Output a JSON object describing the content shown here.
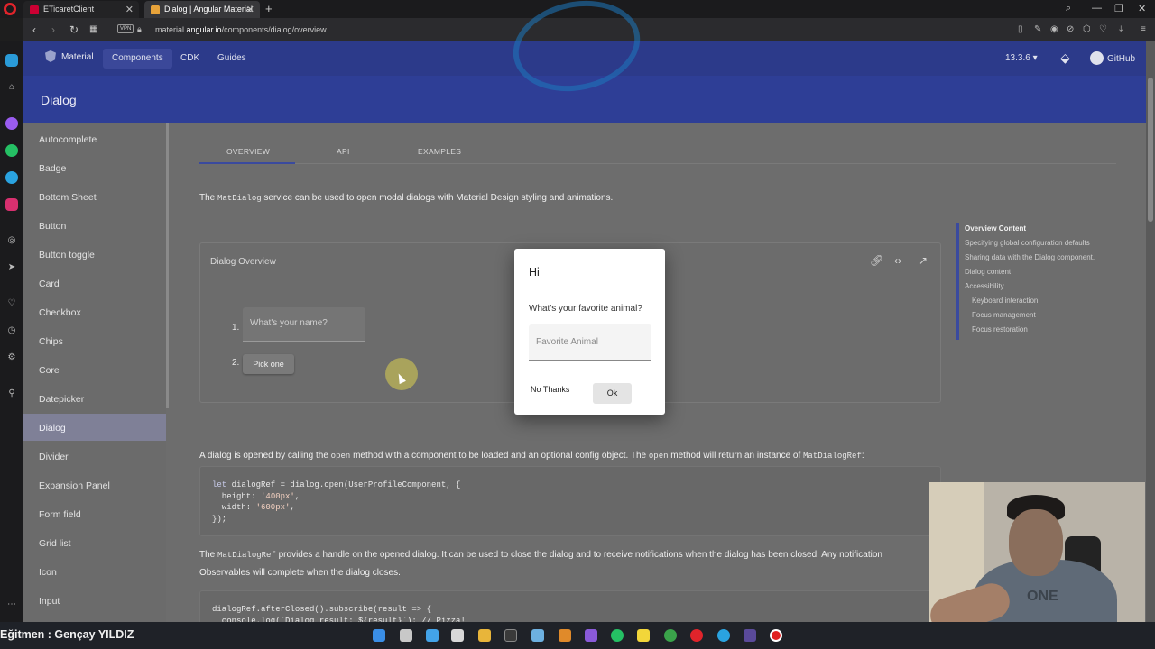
{
  "browser": {
    "tabs": [
      {
        "title": "ETicaretClient"
      },
      {
        "title": "Dialog | Angular Material",
        "active": true
      }
    ],
    "url_prefix": "material.",
    "url_host": "angular.io",
    "url_path": "/components/dialog/overview",
    "vpn_label": "VPN"
  },
  "topnav": {
    "brand": "Material",
    "links": [
      "Components",
      "CDK",
      "Guides"
    ],
    "active_link": "Components",
    "version": "13.3.6",
    "github": "GitHub"
  },
  "header": {
    "title": "Dialog"
  },
  "sidenav": {
    "items": [
      "Autocomplete",
      "Badge",
      "Bottom Sheet",
      "Button",
      "Button toggle",
      "Card",
      "Checkbox",
      "Chips",
      "Core",
      "Datepicker",
      "Dialog",
      "Divider",
      "Expansion Panel",
      "Form field",
      "Grid list",
      "Icon",
      "Input"
    ],
    "active": "Dialog"
  },
  "content": {
    "tabs": [
      "OVERVIEW",
      "API",
      "EXAMPLES"
    ],
    "intro_before": "The",
    "intro_code": "MatDialog",
    "intro_after": "service can be used to open modal dialogs with Material Design styling and animations.",
    "example": {
      "title": "Dialog Overview",
      "step1": "1.",
      "step2": "2.",
      "name_placeholder": "What's your name?",
      "pick_button": "Pick one"
    },
    "para2": {
      "a": "A dialog is opened by calling the",
      "code1": "open",
      "b": "method with a component to be loaded and an optional config object. The",
      "code2": "open",
      "c": "method will return an instance of",
      "code3": "MatDialogRef",
      "d": ":"
    },
    "code1": {
      "l1a": "let",
      "l1b": " dialogRef = dialog.open(UserProfileComponent, {",
      "l2a": "  height: ",
      "l2b": "'400px'",
      "l2c": ",",
      "l3a": "  width: ",
      "l3b": "'600px'",
      "l3c": ",",
      "l4": "});"
    },
    "para3": {
      "a": "The",
      "code": "MatDialogRef",
      "b": "provides a handle on the opened dialog. It can be used to close the dialog and to receive notifications when the dialog has been closed. Any notification",
      "line2": "Observables will complete when the dialog closes."
    },
    "code2": {
      "l1": "dialogRef.afterClosed().subscribe(result => {",
      "l2": "  console.log(`Dialog result: ${result}`); // Pizza!"
    }
  },
  "toc": {
    "items": [
      "Overview Content",
      "Specifying global configuration defaults",
      "Sharing data with the Dialog component.",
      "Dialog content",
      "Accessibility",
      "Keyboard interaction",
      "Focus management",
      "Focus restoration"
    ]
  },
  "dialog": {
    "title": "Hi",
    "question": "What's your favorite animal?",
    "placeholder": "Favorite Animal",
    "no_label": "No Thanks",
    "ok_label": "Ok"
  },
  "overlay": {
    "caption": "Eğitmen : Gençay YILDIZ",
    "webcam_shirt": "ONE"
  },
  "colors": {
    "primary": "#2c3a8a",
    "header": "#2e3e96",
    "taskbar": "#1f2228"
  }
}
